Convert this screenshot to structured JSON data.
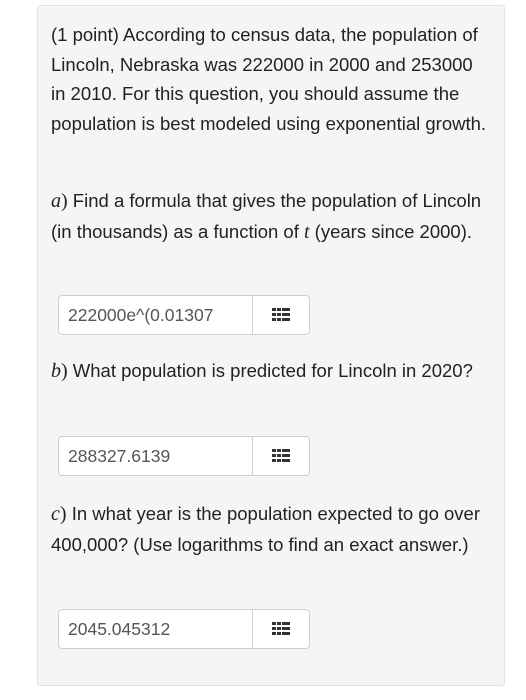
{
  "intro_text": "(1 point) According to census data, the population of Lincoln, Nebraska was 222000 in 2000 and 253000 in 2010. For this question, you should assume the population is best modeled using exponential growth.",
  "questions": [
    {
      "letter": "a",
      "paren": ")",
      "text_before": " Find a formula that gives the population of Lincoln (in thousands) as a function of ",
      "var_t": "t",
      "text_after": " (years since 2000).",
      "answer_value": "222000e^(0.01307"
    },
    {
      "letter": "b",
      "paren": ")",
      "text": " What population is predicted for Lincoln in 2020?",
      "answer_value": "288327.6139"
    },
    {
      "letter": "c",
      "paren": ")",
      "text": " In what year is the population expected to go over 400,000? (Use logarithms to find an exact answer.)",
      "answer_value": "2045.045312"
    }
  ],
  "icons": {
    "equation_editor": "grid-icon"
  }
}
